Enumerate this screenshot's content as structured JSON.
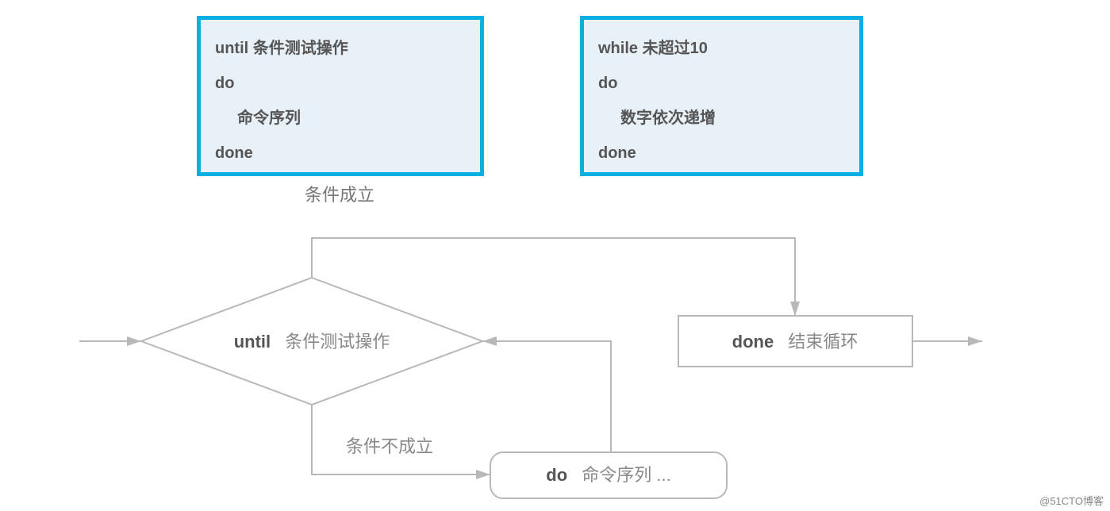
{
  "left_box": {
    "line1_kw": "until",
    "line1_rest": " 条件测试操作",
    "line2": "do",
    "line3": "命令序列",
    "line4": "done"
  },
  "right_box": {
    "line1_kw": "while",
    "line1_rest": " 未超过10",
    "line2": "do",
    "line3": "数字依次递增",
    "line4": "done"
  },
  "caption_top": "条件成立",
  "flow": {
    "until_kw": "until",
    "until_rest": "条件测试操作",
    "cond_false": "条件不成立",
    "do_kw": "do",
    "do_rest": "命令序列 ...",
    "done_kw": "done",
    "done_rest": "结束循环"
  },
  "watermark": "@51CTO博客"
}
